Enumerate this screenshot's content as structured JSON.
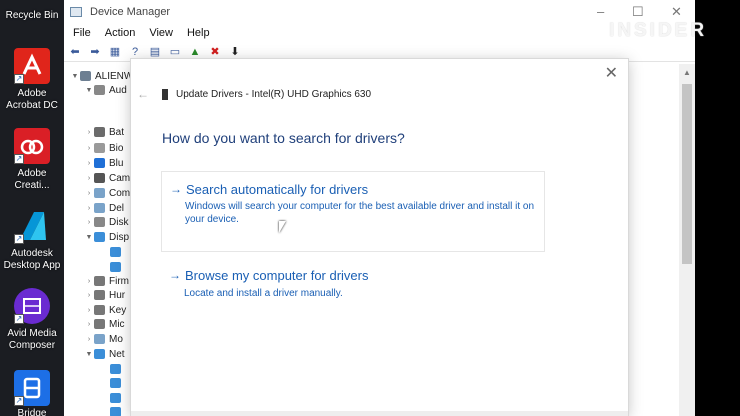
{
  "desktop": {
    "icons": [
      {
        "label": "Recycle Bin",
        "icon": "recycle-bin-icon",
        "color": "#6b8fb5"
      },
      {
        "label": "Adobe Acrobat DC",
        "icon": "acrobat-icon",
        "color": "#e0251b"
      },
      {
        "label": "Adobe Creati...",
        "icon": "creative-cloud-icon",
        "color": "#da1f26"
      },
      {
        "label": "Autodesk Desktop App",
        "icon": "autodesk-icon",
        "color": "#0696d7"
      },
      {
        "label": "Avid Media Composer",
        "icon": "avid-icon",
        "color": "#6a2bd1"
      },
      {
        "label": "Bridge",
        "icon": "bridge-icon",
        "color": "#1d6fe6"
      }
    ]
  },
  "window": {
    "title": "Device Manager",
    "watermark": "INSIDER",
    "menu": [
      "File",
      "Action",
      "View",
      "Help"
    ],
    "tree": {
      "root": "ALIENW",
      "items": [
        "Aud",
        "Bat",
        "Bio",
        "Blu",
        "Cam",
        "Com",
        "Del",
        "Disk",
        "Disp",
        "Firm",
        "Hur",
        "Key",
        "Mic",
        "Mo",
        "Net"
      ]
    }
  },
  "dialog": {
    "title": "Update Drivers - Intel(R) UHD Graphics 630",
    "heading": "How do you want to search for drivers?",
    "option1": {
      "arrow": "→",
      "label": "Search automatically for drivers",
      "description": "Windows will search your computer for the best available driver and install it on your device."
    },
    "option2": {
      "arrow": "→",
      "label": "Browse my computer for drivers",
      "description": "Locate and install a driver manually."
    },
    "accent": "#1a5fb4"
  }
}
